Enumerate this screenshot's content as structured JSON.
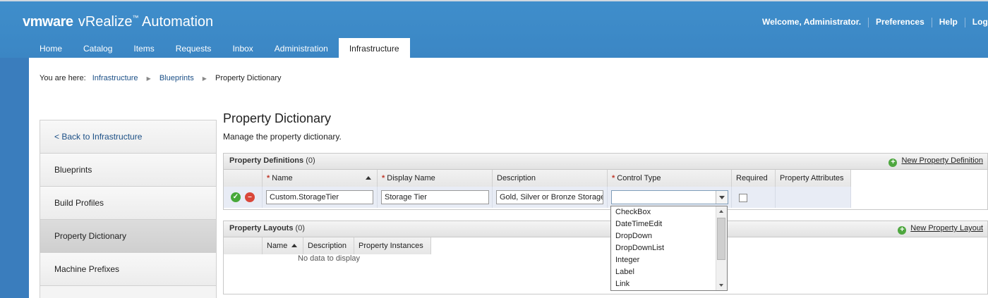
{
  "header": {
    "brand_logo": "vmware",
    "product_name": "vRealize",
    "product_suffix": " Automation",
    "welcome": "Welcome, Administrator.",
    "preferences": "Preferences",
    "help": "Help",
    "logout": "Logou"
  },
  "tabs": [
    {
      "label": "Home"
    },
    {
      "label": "Catalog"
    },
    {
      "label": "Items"
    },
    {
      "label": "Requests"
    },
    {
      "label": "Inbox"
    },
    {
      "label": "Administration"
    },
    {
      "label": "Infrastructure"
    }
  ],
  "active_tab": "Infrastructure",
  "breadcrumb": {
    "prefix": "You are here:",
    "items": [
      "Infrastructure",
      "Blueprints",
      "Property Dictionary"
    ]
  },
  "sidebar": {
    "items": [
      {
        "label": "< Back to Infrastructure"
      },
      {
        "label": "Blueprints"
      },
      {
        "label": "Build Profiles"
      },
      {
        "label": "Property Dictionary"
      },
      {
        "label": "Machine Prefixes"
      }
    ],
    "active": "Property Dictionary"
  },
  "page": {
    "title": "Property Dictionary",
    "subtitle": "Manage the property dictionary."
  },
  "definitions": {
    "title": "Property Definitions",
    "count": "(0)",
    "new_action": "New Property Definition",
    "columns": [
      "Name",
      "Display Name",
      "Description",
      "Control Type",
      "Required",
      "Property Attributes"
    ],
    "edit_row": {
      "name": "Custom.StorageTier",
      "display_name": "Storage Tier",
      "description": "Gold, Silver or Bronze Storage",
      "control_type": "",
      "required": false
    }
  },
  "control_type_options": [
    "CheckBox",
    "DateTimeEdit",
    "DropDown",
    "DropDownList",
    "Integer",
    "Label",
    "Link"
  ],
  "layouts": {
    "title": "Property Layouts",
    "count": "(0)",
    "new_action": "New Property Layout",
    "columns": [
      "Name",
      "Description",
      "Property Instances"
    ],
    "empty_text": "No data to display"
  }
}
